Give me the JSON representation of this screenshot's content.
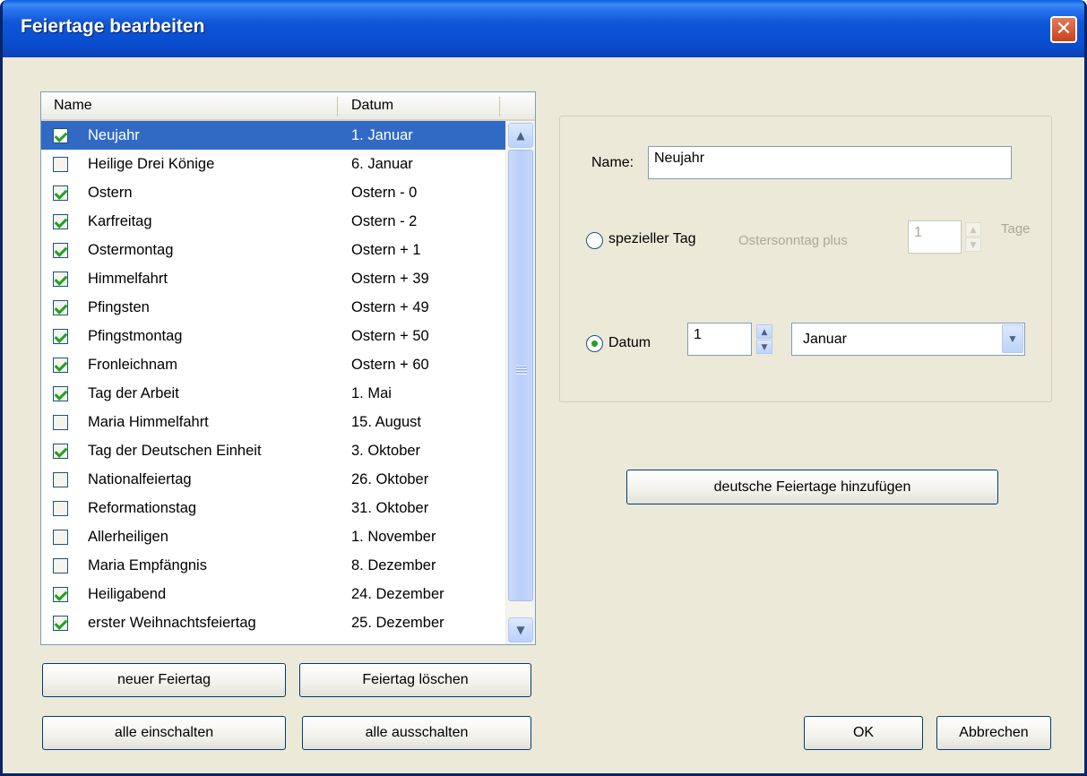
{
  "window": {
    "title": "Feiertage bearbeiten",
    "close": "✕"
  },
  "list": {
    "columns": {
      "name": "Name",
      "date": "Datum"
    },
    "rows": [
      {
        "name": "Neujahr",
        "date": "1. Januar",
        "checked": true,
        "selected": true
      },
      {
        "name": "Heilige Drei Könige",
        "date": "6. Januar",
        "checked": false
      },
      {
        "name": "Ostern",
        "date": "Ostern - 0",
        "checked": true
      },
      {
        "name": "Karfreitag",
        "date": "Ostern - 2",
        "checked": true
      },
      {
        "name": "Ostermontag",
        "date": "Ostern + 1",
        "checked": true
      },
      {
        "name": "Himmelfahrt",
        "date": "Ostern + 39",
        "checked": true
      },
      {
        "name": "Pfingsten",
        "date": "Ostern + 49",
        "checked": true
      },
      {
        "name": "Pfingstmontag",
        "date": "Ostern + 50",
        "checked": true
      },
      {
        "name": "Fronleichnam",
        "date": "Ostern + 60",
        "checked": true
      },
      {
        "name": "Tag der Arbeit",
        "date": "1. Mai",
        "checked": true
      },
      {
        "name": "Maria Himmelfahrt",
        "date": "15. August",
        "checked": false
      },
      {
        "name": "Tag der Deutschen Einheit",
        "date": "3. Oktober",
        "checked": true
      },
      {
        "name": "Nationalfeiertag",
        "date": "26. Oktober",
        "checked": false
      },
      {
        "name": "Reformationstag",
        "date": "31. Oktober",
        "checked": false
      },
      {
        "name": "Allerheiligen",
        "date": "1. November",
        "checked": false
      },
      {
        "name": "Maria Empfängnis",
        "date": "8. Dezember",
        "checked": false
      },
      {
        "name": "Heiligabend",
        "date": "24. Dezember",
        "checked": true
      },
      {
        "name": "erster Weihnachtsfeiertag",
        "date": "25. Dezember",
        "checked": true
      }
    ]
  },
  "buttons": {
    "new": "neuer Feiertag",
    "delete": "Feiertag löschen",
    "enable_all": "alle einschalten",
    "disable_all": "alle ausschalten",
    "add_german": "deutsche Feiertage hinzufügen",
    "ok": "OK",
    "cancel": "Abbrechen"
  },
  "form": {
    "name_label": "Name:",
    "name_value": "Neujahr",
    "special_label": "spezieller Tag",
    "easter_label": "Ostersonntag plus",
    "easter_value": "1",
    "days_label": "Tage",
    "date_label": "Datum",
    "day_value": "1",
    "month_value": "Januar"
  },
  "colors": {
    "selection": "#316ac5",
    "titlebar": "#0a4fd2",
    "background": "#ece9d8"
  }
}
